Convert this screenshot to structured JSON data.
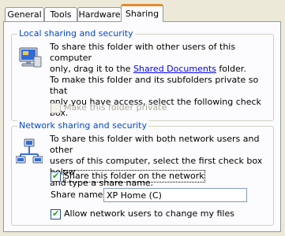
{
  "tabs": [
    "General",
    "Tools",
    "Hardware",
    "Sharing"
  ],
  "active_tab": "Sharing",
  "local": {
    "legend": "Local sharing and security",
    "para1_part1": "To share this folder with other users of this computer",
    "para1_part2": "only, drag it to the ",
    "para1_link": "Shared Documents",
    "para1_part3": " folder.",
    "para2_line1": "To make this folder and its subfolders private so that",
    "para2_line2": "only you have access, select the following check box.",
    "private_checkbox_label": "Make this folder private",
    "private_checked": false,
    "private_enabled": false
  },
  "network": {
    "legend": "Network sharing and security",
    "para_line1": "To share this folder with both network users and other",
    "para_line2": "users of this computer, select the first check box below",
    "para_line3": "and type a share name.",
    "share_checkbox_label": "Share this folder on the network",
    "share_checked": true,
    "share_name_label": "Share name:",
    "share_name_value": "XP Home (C)",
    "allow_change_label": "Allow network users to change my files",
    "allow_change_checked": true
  },
  "icons": {
    "local_icon": "computer-folder-icon",
    "network_icon": "network-icon"
  }
}
